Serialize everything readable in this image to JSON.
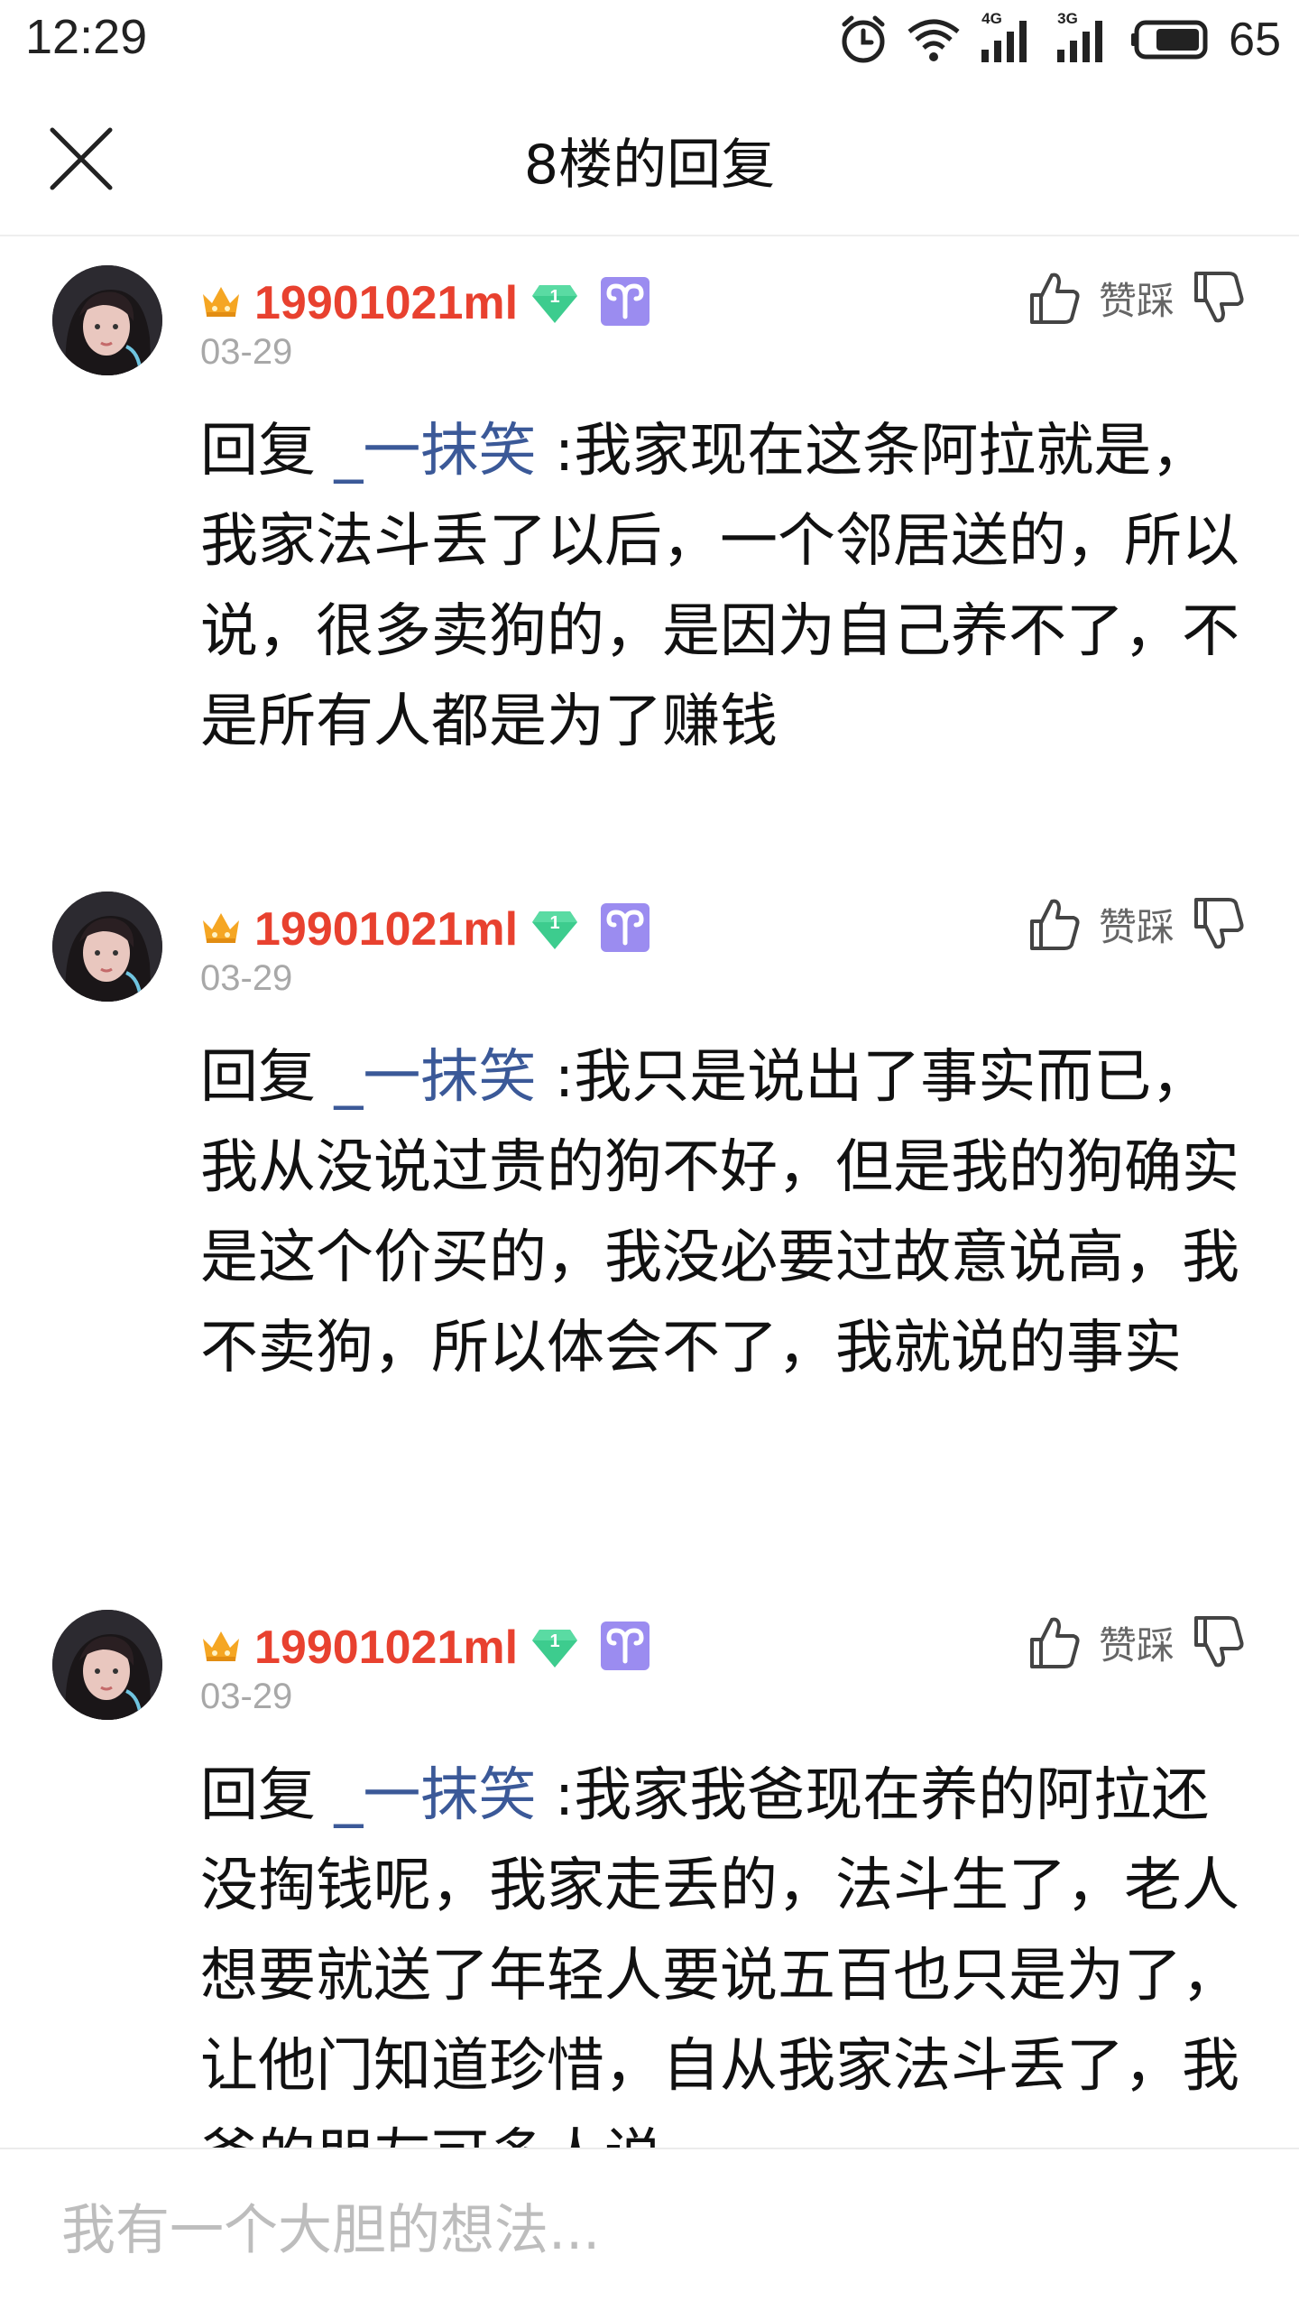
{
  "status_bar": {
    "time": "12:29",
    "net1": "4G",
    "net2": "3G",
    "battery": "65"
  },
  "header": {
    "title": "8楼的回复",
    "close_icon": "close-icon"
  },
  "colors": {
    "username": "#e8412f",
    "reply_link": "#3b5998",
    "date": "#a8a8a8",
    "level_badge": "#3dcc8e",
    "zodiac_badge": "#9b8cf0",
    "crown": "#f5a623"
  },
  "posts": [
    {
      "username": "19901021ml",
      "level": "1",
      "date": "03-29",
      "vote_label": "赞踩",
      "reply_prefix": "回复 ",
      "reply_to": "_一抹笑",
      "text": " :我家现在这条阿拉就是，我家法斗丢了以后，一个邻居送的，所以说，很多卖狗的，是因为自己养不了，不是所有人都是为了赚钱"
    },
    {
      "username": "19901021ml",
      "level": "1",
      "date": "03-29",
      "vote_label": "赞踩",
      "reply_prefix": "回复 ",
      "reply_to": "_一抹笑",
      "text": " :我只是说出了事实而已，我从没说过贵的狗不好，但是我的狗确实是这个价买的，我没必要过故意说高，我不卖狗，所以体会不了，我就说的事实"
    },
    {
      "username": "19901021ml",
      "level": "1",
      "date": "03-29",
      "vote_label": "赞踩",
      "reply_prefix": "回复 ",
      "reply_to": "_一抹笑",
      "text": " :我家我爸现在养的阿拉还没掏钱呢，我家走丢的，法斗生了，老人想要就送了年轻人要说五百也只是为了，让他门知道珍惜，自从我家法斗丢了，我爸的朋友可多人说"
    }
  ],
  "composer": {
    "placeholder": "我有一个大胆的想法..."
  }
}
